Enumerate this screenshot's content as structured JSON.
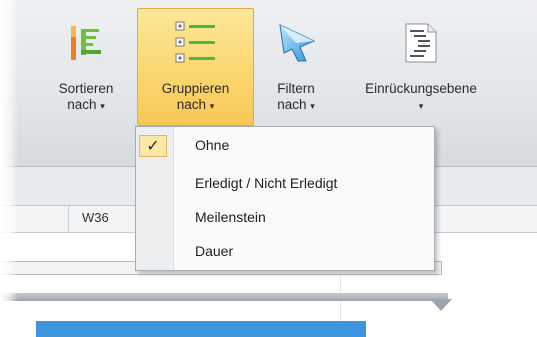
{
  "ribbon": {
    "buttons": [
      {
        "label_line1": "Sortieren",
        "label_line2": "nach",
        "icon": "sort-bars-icon"
      },
      {
        "label_line1": "Gruppieren",
        "label_line2": "nach",
        "icon": "group-list-icon",
        "active": true
      },
      {
        "label_line1": "Filtern",
        "label_line2": "nach",
        "icon": "funnel-icon"
      },
      {
        "label_line1": "Einrückungsebene",
        "label_line2": "",
        "icon": "indent-level-icon"
      }
    ],
    "caret": "▾"
  },
  "timeline": {
    "week_label": "W36"
  },
  "group_menu": {
    "items": [
      {
        "label": "Ohne",
        "checked": true
      },
      {
        "label": "Erledigt / Nicht Erledigt"
      },
      {
        "label": "Meilenstein"
      },
      {
        "label": "Dauer"
      }
    ],
    "check_glyph": "✓"
  },
  "colors": {
    "active_button": "#fbd973",
    "task_bar": "#3d95e0",
    "checkmark_bg": "#fde7a7"
  }
}
